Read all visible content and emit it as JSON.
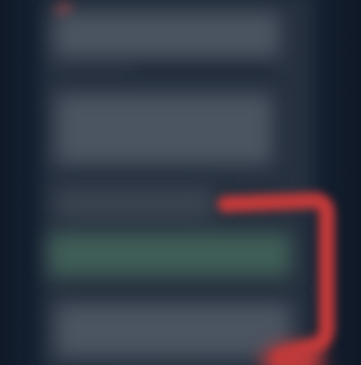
{
  "screen": {
    "description_visible_text": ""
  },
  "colors": {
    "background": "#131d2c",
    "panel": "#27313f",
    "text_block": "#4b5461",
    "highlight_row": "#3f5e57",
    "annotation": "#c43a3a"
  },
  "panel": {
    "blocks": [
      {
        "kind": "text",
        "text": ""
      },
      {
        "kind": "text",
        "text": ""
      },
      {
        "kind": "text",
        "text": ""
      },
      {
        "kind": "highlighted-row",
        "text": ""
      },
      {
        "kind": "text",
        "text": ""
      }
    ]
  },
  "annotation": {
    "shape": "red-bracket"
  }
}
